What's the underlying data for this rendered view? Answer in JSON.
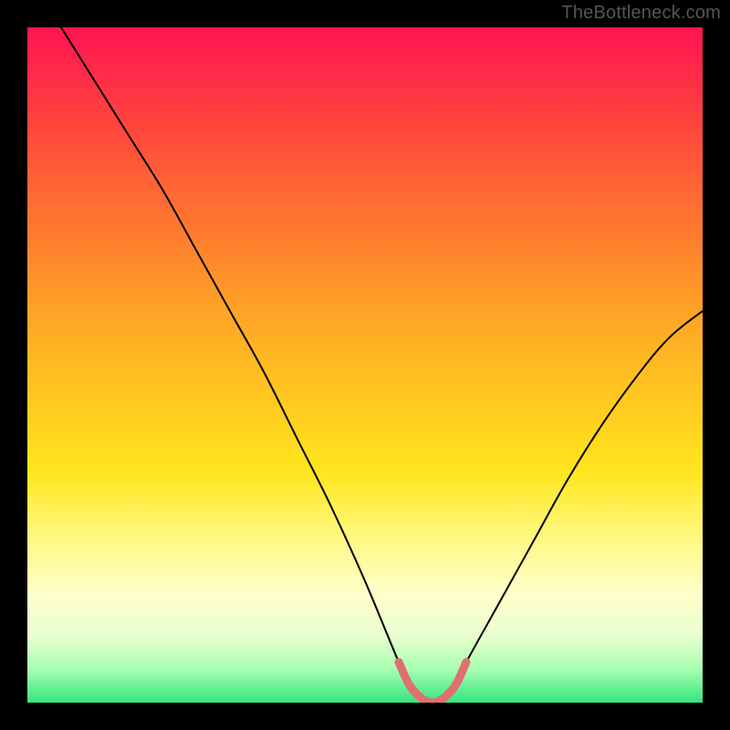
{
  "watermark": "TheBottleneck.com",
  "chart_data": {
    "type": "line",
    "title": "",
    "xlabel": "",
    "ylabel": "",
    "xlim": [
      0,
      100
    ],
    "ylim": [
      0,
      100
    ],
    "grid": false,
    "legend": false,
    "x": [
      0,
      5,
      10,
      15,
      20,
      25,
      30,
      35,
      40,
      45,
      50,
      55,
      57,
      60,
      63,
      65,
      70,
      75,
      80,
      85,
      90,
      95,
      100
    ],
    "values": [
      108,
      100,
      92,
      84,
      76,
      67,
      58,
      49,
      39,
      29,
      18,
      6,
      2,
      0,
      2,
      6,
      15,
      24,
      33,
      41,
      48,
      54,
      58
    ],
    "highlight_range_x": [
      55,
      65
    ],
    "notes": "V-shaped bottleneck curve over a red-to-green vertical gradient; pink/salmon highlighted segment near the valley floor."
  }
}
